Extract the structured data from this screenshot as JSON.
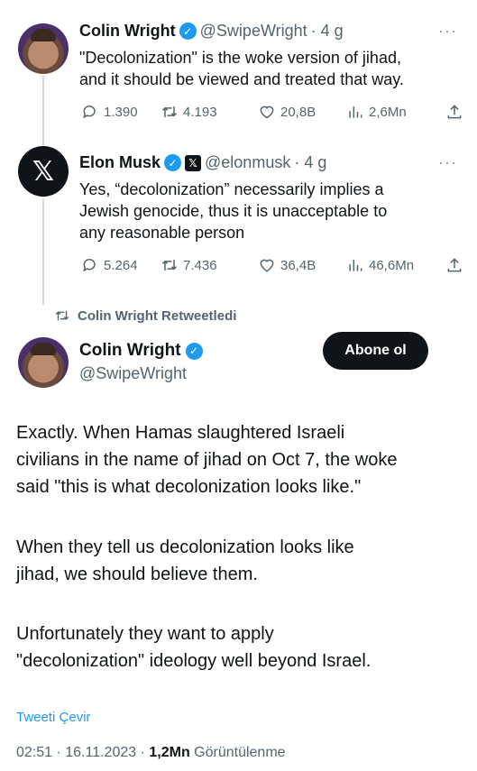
{
  "tweet1": {
    "name": "Colin Wright",
    "handle": "@SwipeWright",
    "time": "· 4 g",
    "more": "···",
    "line1": "\"Decolonization\" is the woke version of jihad,",
    "line2": "and it should be viewed and treated that way.",
    "replies": "1.390",
    "retweets": "4.193",
    "likes": "20,8B",
    "views": "2,6Mn"
  },
  "tweet2": {
    "name": "Elon Musk",
    "handle": "@elonmusk",
    "time": "· 4 g",
    "more": "···",
    "avatar_glyph": "𝕏",
    "badge_glyph": "𝕏",
    "line1": "Yes, “decolonization” necessarily implies a",
    "line2": "Jewish genocide, thus it is unacceptable to",
    "line3": "any reasonable person",
    "replies": "5.264",
    "retweets": "7.436",
    "likes": "36,4B",
    "views": "46,6Mn"
  },
  "retweeted_by": "Colin Wright Retweetledi",
  "main": {
    "name": "Colin Wright",
    "handle": "@SwipeWright",
    "follow_label": "Abone ol",
    "p1_l1": "Exactly. When Hamas slaughtered Israeli",
    "p1_l2": "civilians in the name of jihad on Oct 7, the woke",
    "p1_l3": "said \"this is what decolonization looks like.\"",
    "p2_l1": "When they tell us decolonization looks like",
    "p2_l2": "jihad, we should believe them.",
    "p3_l1": "Unfortunately they want to apply",
    "p3_l2": "\"decolonization\" ideology well beyond Israel.",
    "translate": "Tweeti Çevir",
    "timestamp": "02:51 · 16.11.2023 · ",
    "views": "1,2Mn",
    "views_label": " Görüntülenme"
  },
  "colors": {
    "accent": "#1d9bf0",
    "text": "#0f1419",
    "secondary": "#536471",
    "thread_line": "#cfd9de"
  },
  "icons": [
    "reply-icon",
    "retweet-icon",
    "like-icon",
    "views-icon",
    "share-icon",
    "verified-icon",
    "x-logo-icon"
  ]
}
